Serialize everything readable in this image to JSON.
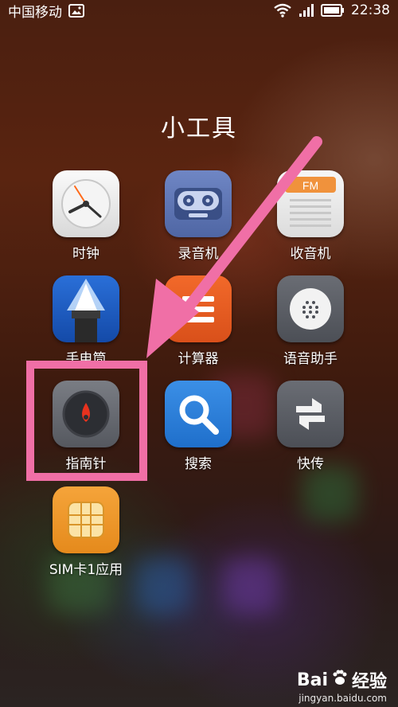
{
  "status_bar": {
    "carrier": "中国移动",
    "time": "22:38",
    "icons": [
      "image-icon",
      "wifi-icon",
      "signal-icon",
      "battery-icon"
    ]
  },
  "folder": {
    "title": "小工具",
    "apps": [
      {
        "label": "时钟",
        "icon": "clock-icon"
      },
      {
        "label": "录音机",
        "icon": "recorder-icon"
      },
      {
        "label": "收音机",
        "icon": "radio-icon",
        "badge": "FM"
      },
      {
        "label": "手电筒",
        "icon": "flashlight-icon"
      },
      {
        "label": "计算器",
        "icon": "calculator-icon"
      },
      {
        "label": "语音助手",
        "icon": "voice-assistant-icon"
      },
      {
        "label": "指南针",
        "icon": "compass-icon"
      },
      {
        "label": "搜索",
        "icon": "search-icon"
      },
      {
        "label": "快传",
        "icon": "transfer-icon"
      },
      {
        "label": "SIM卡1应用",
        "icon": "sim-card-icon"
      }
    ]
  },
  "annotation": {
    "highlight_color": "#f06fa6",
    "target": "指南针"
  },
  "watermark": {
    "brand_prefix": "Bai",
    "brand_suffix": "经验",
    "url": "jingyan.baidu.com"
  }
}
